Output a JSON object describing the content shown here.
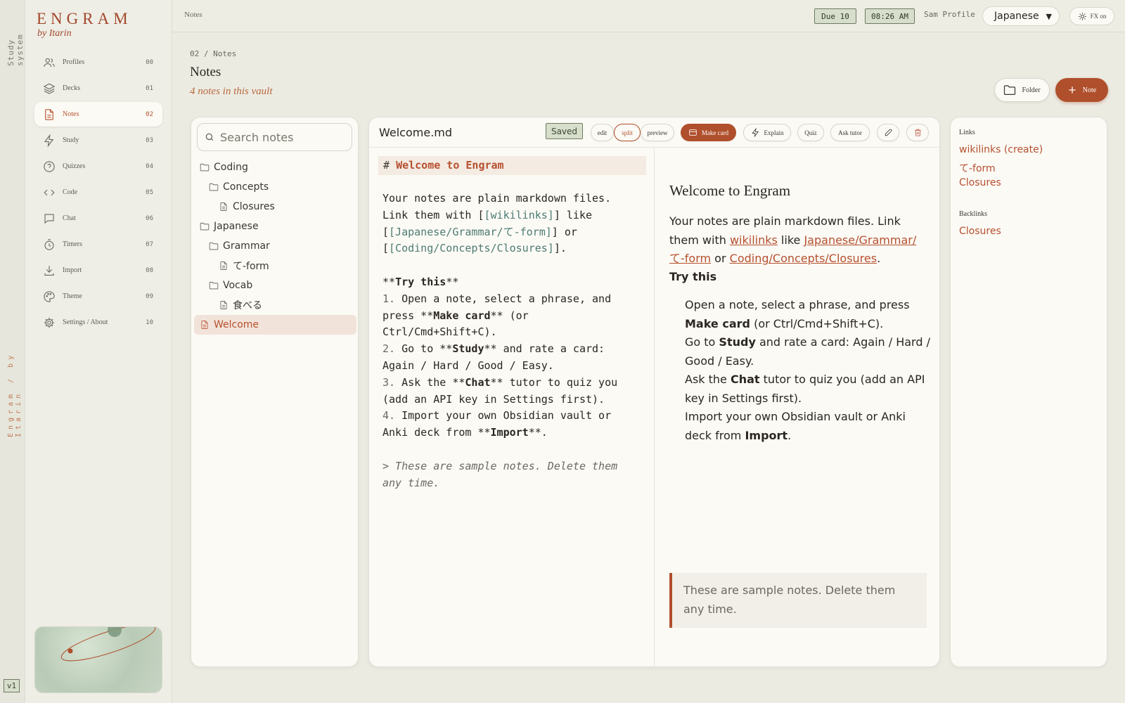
{
  "rail": {
    "top_label": "Study system",
    "middle_label": "Engram / by Itarin",
    "version": "v1"
  },
  "brand": {
    "title": "ENGRAM",
    "subtitle": "by Itarin"
  },
  "nav": [
    {
      "label": "Profiles",
      "num": "00",
      "icon": "profiles-icon"
    },
    {
      "label": "Decks",
      "num": "01",
      "icon": "layers-icon"
    },
    {
      "label": "Notes",
      "num": "02",
      "icon": "document-icon",
      "active": true
    },
    {
      "label": "Study",
      "num": "03",
      "icon": "lightning-icon"
    },
    {
      "label": "Quizzes",
      "num": "04",
      "icon": "question-icon"
    },
    {
      "label": "Code",
      "num": "05",
      "icon": "code-icon"
    },
    {
      "label": "Chat",
      "num": "06",
      "icon": "chat-icon"
    },
    {
      "label": "Timers",
      "num": "07",
      "icon": "timer-icon"
    },
    {
      "label": "Import",
      "num": "08",
      "icon": "download-icon"
    },
    {
      "label": "Theme",
      "num": "09",
      "icon": "palette-icon"
    },
    {
      "label": "Settings / About",
      "num": "10",
      "icon": "gear-icon"
    }
  ],
  "topbar": {
    "crumb": "Notes",
    "due": "Due 10",
    "time": "08:26 AM",
    "profile": "Sam Profile",
    "language": "Japanese",
    "fx": "FX on"
  },
  "page": {
    "crumb": "02 / Notes",
    "title": "Notes",
    "subtitle": "4 notes in this vault",
    "folder_button": "Folder",
    "note_button": "Note"
  },
  "tree": {
    "search_placeholder": "Search notes",
    "items": [
      {
        "label": "Coding",
        "type": "folder",
        "depth": 0
      },
      {
        "label": "Concepts",
        "type": "folder",
        "depth": 1
      },
      {
        "label": "Closures",
        "type": "file",
        "depth": 2
      },
      {
        "label": "Japanese",
        "type": "folder",
        "depth": 0
      },
      {
        "label": "Grammar",
        "type": "folder",
        "depth": 1
      },
      {
        "label": "て-form",
        "type": "file",
        "depth": 2
      },
      {
        "label": "Vocab",
        "type": "folder",
        "depth": 1
      },
      {
        "label": "食べる",
        "type": "file",
        "depth": 2
      },
      {
        "label": "Welcome",
        "type": "file",
        "depth": 0,
        "active": true
      }
    ]
  },
  "editor": {
    "file_name": "Welcome.md",
    "status": "Saved",
    "modes": {
      "edit": "edit",
      "split": "split",
      "preview": "preview"
    },
    "actions": {
      "make_card": "Make card",
      "explain": "Explain",
      "quiz": "Quiz",
      "ask_tutor": "Ask tutor"
    },
    "source": {
      "h1_hash": "#",
      "h1_text": "Welcome to Engram",
      "p_text_1": "Your notes are plain markdown files.\nLink them with [",
      "link_1": "[wikilinks]",
      "p_text_2": "] like\n[",
      "link_2": "[Japanese/Grammar/て-form]",
      "p_text_3": "] or\n[",
      "link_3": "[Coding/Concepts/Closures]",
      "p_text_4": "].",
      "try_open": "**",
      "try_text": "Try this",
      "try_close": "**",
      "l1_num": "1.",
      "l1_a": " Open a note, select a phrase, and\npress **",
      "l1_b": "Make card",
      "l1_c": "** (or\nCtrl/Cmd+Shift+C).",
      "l2_num": "2.",
      "l2_a": " Go to **",
      "l2_b": "Study",
      "l2_c": "** and rate a card:\nAgain / Hard / Good / Easy.",
      "l3_num": "3.",
      "l3_a": " Ask the **",
      "l3_b": "Chat",
      "l3_c": "** tutor to quiz you\n(add an API key in Settings first).",
      "l4_num": "4.",
      "l4_a": " Import your own Obsidian vault or\nAnki deck from **",
      "l4_b": "Import",
      "l4_c": "**.",
      "quote": "> These are sample notes. Delete them\nany time."
    },
    "preview": {
      "title": "Welcome to Engram",
      "p_1": "Your notes are plain markdown files. Link them with ",
      "link_1": "wikilinks",
      "p_2": " like ",
      "link_2": "Japanese/Grammar/て-form",
      "p_3": " or ",
      "link_3": "Coding/Concepts/Closures",
      "p_4": ".",
      "try_title": "Try this",
      "li1_a": "Open a note, select a phrase, and press ",
      "li1_b": "Make card",
      "li1_c": " (or Ctrl/Cmd+Shift+C).",
      "li2_a": "Go to ",
      "li2_b": "Study",
      "li2_c": " and rate a card: Again / Hard / Good / Easy.",
      "li3_a": "Ask the ",
      "li3_b": "Chat",
      "li3_c": " tutor to quiz you (add an API key in Settings first).",
      "li4_a": "Import your own Obsidian vault or Anki deck from ",
      "li4_b": "Import",
      "li4_c": ".",
      "quote": "These are sample notes. Delete them any time."
    }
  },
  "links_panel": {
    "links_title": "Links",
    "links": [
      "wikilinks (create)",
      "て-form",
      "Closures"
    ],
    "backlinks_title": "Backlinks",
    "backlinks": [
      "Closures"
    ]
  },
  "colors": {
    "accent": "#b04f2c",
    "status_bg": "#d7dfcc",
    "background": "#ecebe2",
    "panel": "#fbfaf5"
  }
}
